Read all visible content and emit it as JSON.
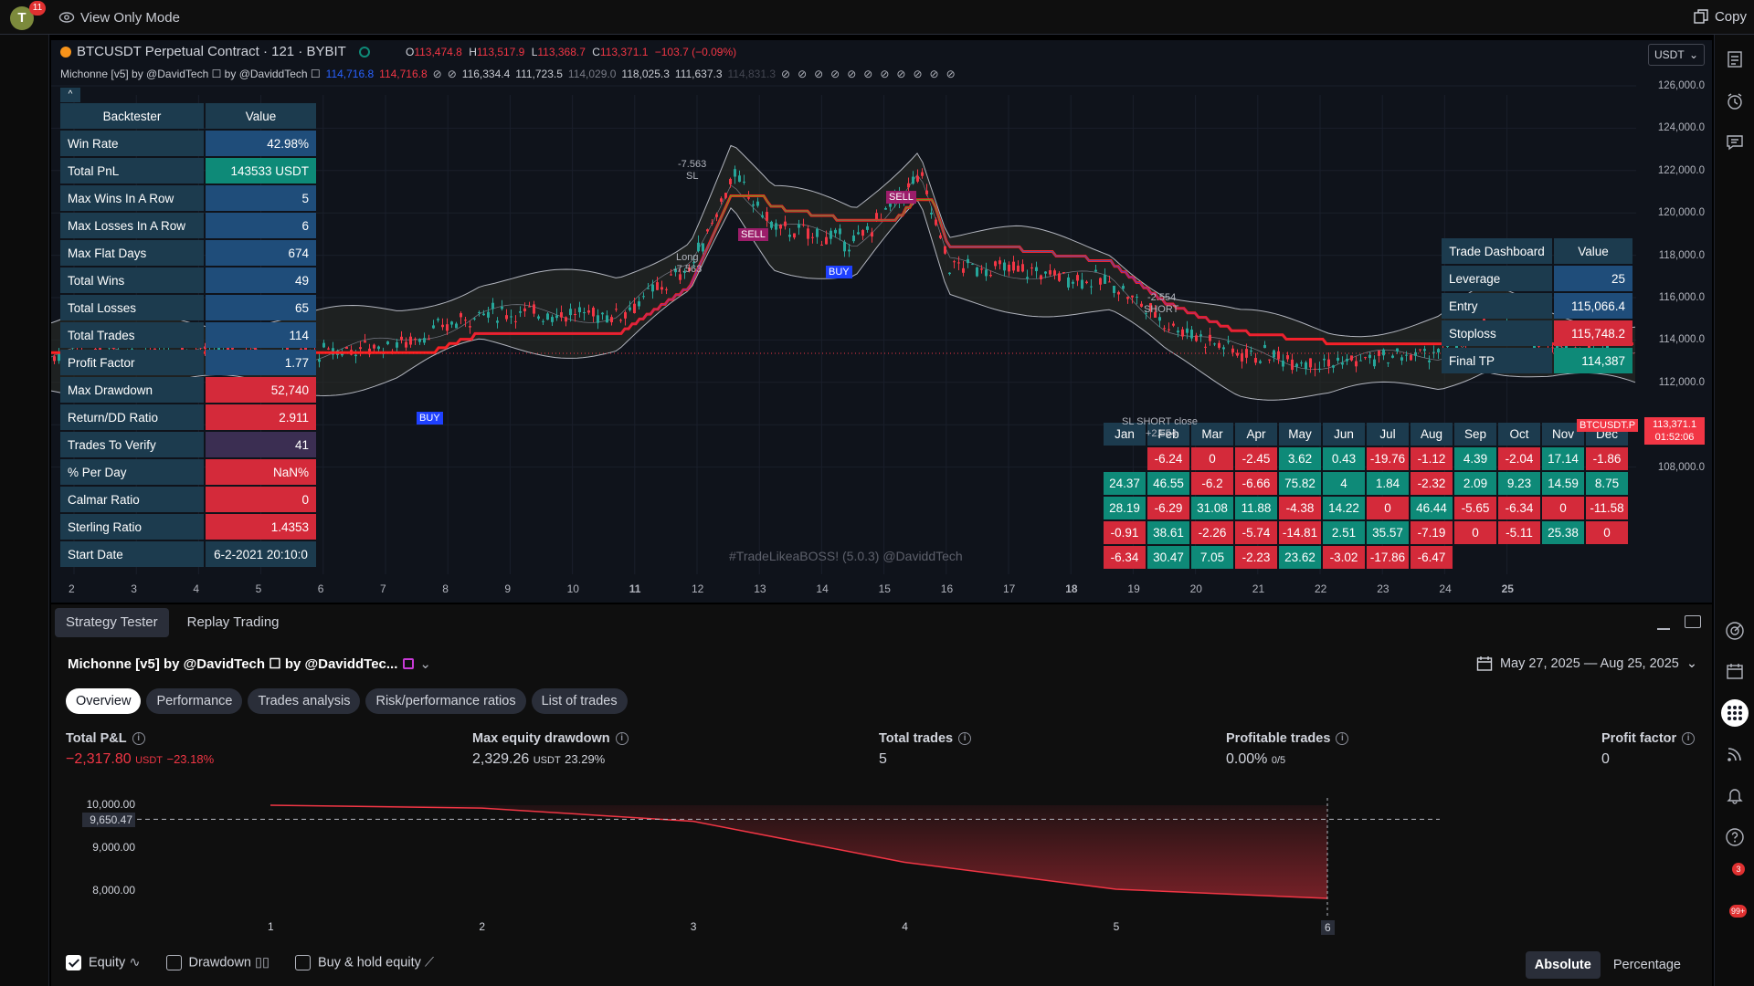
{
  "topbar": {
    "avatar_letter": "T",
    "avatar_badge": "11",
    "view_mode": "View Only Mode",
    "copy_label": "Copy"
  },
  "chart": {
    "symbol": "BTCUSDT Perpetual Contract · 121 · BYBIT",
    "ohlc": {
      "o_label": "O",
      "o": "113,474.8",
      "h_label": "H",
      "h": "113,517.9",
      "l_label": "L",
      "l": "113,368.7",
      "c_label": "C",
      "c": "113,371.1",
      "change": "−103.7 (−0.09%)"
    },
    "indicator_name": "Michonne [v5] by @DavidTech ☐ by @DaviddTech ☐",
    "indicator_values": [
      "114,716.8",
      "114,716.8",
      "116,334.4",
      "111,723.5",
      "114,029.0",
      "118,025.3",
      "111,637.3",
      "114,831.3"
    ],
    "currency": "USDT",
    "watermark": "#TradeLikeaBOSS! (5.0.3) @DaviddTech",
    "y_ticks": [
      "126,000.0",
      "124,000.0",
      "122,000.0",
      "120,000.0",
      "118,000.0",
      "116,000.0",
      "114,000.0",
      "112,000.0",
      "110,000.0",
      "108,000.0"
    ],
    "x_ticks": [
      "2",
      "3",
      "4",
      "5",
      "6",
      "7",
      "8",
      "9",
      "10",
      "11",
      "12",
      "13",
      "14",
      "15",
      "16",
      "17",
      "18",
      "19",
      "20",
      "21",
      "22",
      "23",
      "24",
      "25"
    ],
    "last_price_tag": {
      "price": "113,371.1",
      "time": "01:52:06",
      "symbol": "BTCUSDT.P"
    },
    "signals": {
      "buy": "BUY",
      "sell": "SELL",
      "short_close": "SL SHORT close",
      "short_close_val": "+2.554",
      "short": "SHORT",
      "short_val": "-2.554",
      "long": "Long",
      "long_val": "-7.563",
      "sl": "SL",
      "sl_val": "-7.563"
    }
  },
  "backtester": {
    "header": [
      "Backtester",
      "Value"
    ],
    "rows": [
      {
        "label": "Win Rate",
        "value": "42.98%",
        "color": "blue"
      },
      {
        "label": "Total PnL",
        "value": "143533 USDT",
        "color": "green"
      },
      {
        "label": "Max Wins In A Row",
        "value": "5",
        "color": "blue"
      },
      {
        "label": "Max Losses In A Row",
        "value": "6",
        "color": "blue"
      },
      {
        "label": "Max Flat Days",
        "value": "674",
        "color": "blue"
      },
      {
        "label": "Total Wins",
        "value": "49",
        "color": "blue"
      },
      {
        "label": "Total Losses",
        "value": "65",
        "color": "blue"
      },
      {
        "label": "Total Trades",
        "value": "114",
        "color": "blue"
      },
      {
        "label": "Profit Factor",
        "value": "1.77",
        "color": "blue"
      },
      {
        "label": "Max Drawdown",
        "value": "52,740",
        "color": "red"
      },
      {
        "label": "Return/DD Ratio",
        "value": "2.911",
        "color": "red"
      },
      {
        "label": "Trades To Verify",
        "value": "41",
        "color": "purple"
      },
      {
        "label": "% Per Day",
        "value": "NaN%",
        "color": "red"
      },
      {
        "label": "Calmar Ratio",
        "value": "0",
        "color": "red"
      },
      {
        "label": "Sterling Ratio",
        "value": "1.4353",
        "color": "red"
      },
      {
        "label": "Start Date",
        "value": "6-2-2021 20:10:0",
        "color": "dark"
      }
    ]
  },
  "trade_dashboard": {
    "header": [
      "Trade Dashboard",
      "Value"
    ],
    "rows": [
      {
        "label": "Leverage",
        "value": "25",
        "color": "blue"
      },
      {
        "label": "Entry",
        "value": "115,066.4",
        "color": "blue"
      },
      {
        "label": "Stoploss",
        "value": "115,748.2",
        "color": "red"
      },
      {
        "label": "Final TP",
        "value": "114,387",
        "color": "green"
      }
    ]
  },
  "monthly": {
    "months": [
      "Jan",
      "Feb",
      "Mar",
      "Apr",
      "May",
      "Jun",
      "Jul",
      "Aug",
      "Sep",
      "Oct",
      "Nov",
      "Dec"
    ],
    "rows": [
      [
        "",
        "-6.24",
        "0",
        "-2.45",
        "3.62",
        "0.43",
        "-19.76",
        "-1.12",
        "4.39",
        "-2.04",
        "17.14",
        "-1.86"
      ],
      [
        "24.37",
        "46.55",
        "-6.2",
        "-6.66",
        "75.82",
        "4",
        "1.84",
        "-2.32",
        "2.09",
        "9.23",
        "14.59",
        "8.75"
      ],
      [
        "28.19",
        "-6.29",
        "31.08",
        "11.88",
        "-4.38",
        "14.22",
        "0",
        "46.44",
        "-5.65",
        "-6.34",
        "0",
        "-11.58"
      ],
      [
        "-0.91",
        "38.61",
        "-2.26",
        "-5.74",
        "-14.81",
        "2.51",
        "35.57",
        "-7.19",
        "0",
        "-5.11",
        "25.38",
        "0"
      ],
      [
        "-6.34",
        "30.47",
        "7.05",
        "-2.23",
        "23.62",
        "-3.02",
        "-17.86",
        "-6.47",
        "",
        "",
        "",
        ""
      ]
    ]
  },
  "bottom": {
    "tabs": [
      "Strategy Tester",
      "Replay Trading"
    ],
    "strategy_name": "Michonne [v5] by @DavidTech ☐ by @DaviddTec...",
    "date_range": "May 27, 2025 — Aug 25, 2025",
    "subtabs": [
      "Overview",
      "Performance",
      "Trades analysis",
      "Risk/performance ratios",
      "List of trades"
    ],
    "metrics": [
      {
        "label": "Total P&L",
        "value": "−2,317.80",
        "unit": "USDT",
        "extra": "−23.18%"
      },
      {
        "label": "Max equity drawdown",
        "value": "2,329.26",
        "unit": "USDT",
        "extra": "23.29%"
      },
      {
        "label": "Total trades",
        "value": "5",
        "unit": "",
        "extra": ""
      },
      {
        "label": "Profitable trades",
        "value": "0.00%",
        "unit": "0/5",
        "extra": ""
      },
      {
        "label": "Profit factor",
        "value": "0",
        "unit": "",
        "extra": ""
      }
    ],
    "equity_chart": {
      "y_ticks": [
        "10,000.00",
        "9,000.00",
        "8,000.00"
      ],
      "marker": "9,650.47",
      "x_ticks": [
        "1",
        "2",
        "3",
        "4",
        "5",
        "6"
      ],
      "equity_values": [
        10000,
        9930,
        9600,
        8580,
        7910,
        7682
      ]
    },
    "legend": [
      "Equity",
      "Drawdown",
      "Buy & hold equity"
    ],
    "mode_buttons": [
      "Absolute",
      "Percentage"
    ]
  },
  "rightbar_badges": {
    "feed": "3",
    "notifications": "99+"
  },
  "colors": {
    "green": "#0e8a78",
    "red": "#d42a3a",
    "blue": "#1f4d7a",
    "header": "#1c3b4e",
    "up": "#26a69a",
    "down": "#f23645"
  }
}
